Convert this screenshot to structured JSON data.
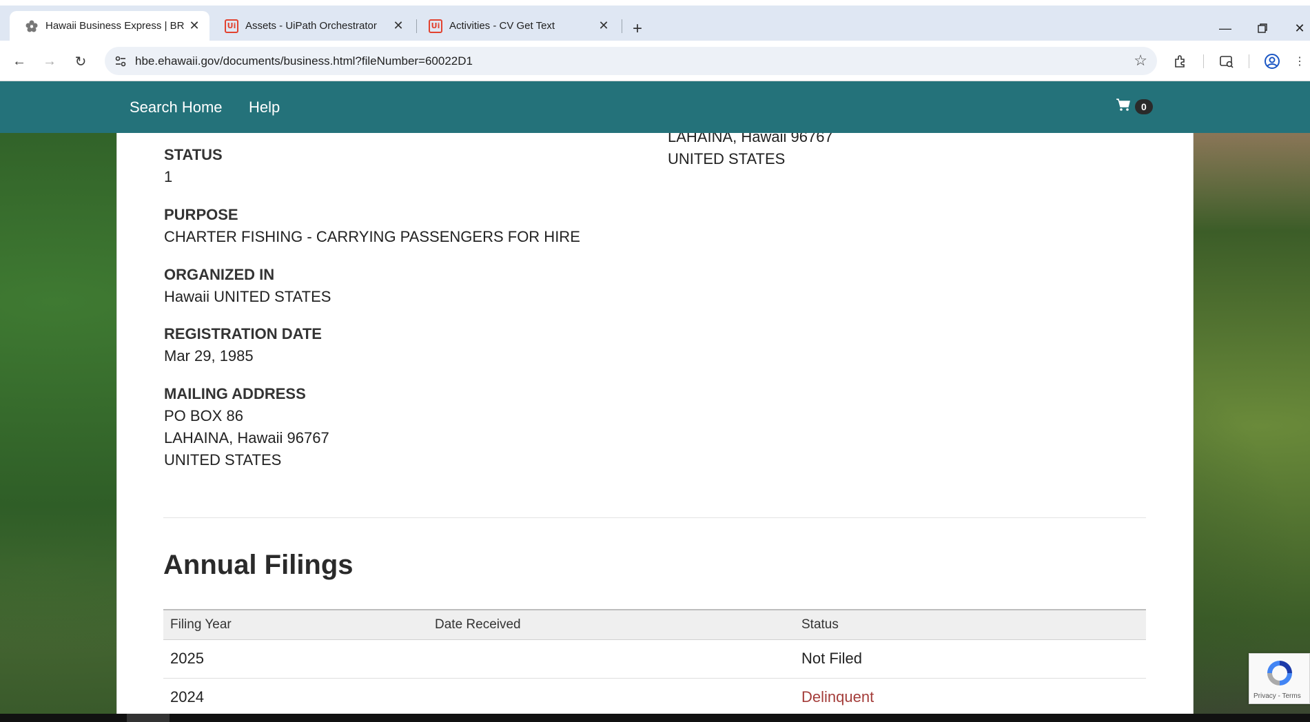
{
  "browser": {
    "tabs": [
      {
        "title": "Hawaii Business Express | BREG",
        "icon": "hibiscus-icon",
        "active": true
      },
      {
        "title": "Assets - UiPath Orchestrator",
        "icon": "uipath-icon",
        "active": false
      },
      {
        "title": "Activities - CV Get Text",
        "icon": "uipath-icon",
        "active": false
      }
    ],
    "uipath_icon_text": "Ui",
    "url": "hbe.ehawaii.gov/documents/business.html?fileNumber=60022D1"
  },
  "header": {
    "nav": [
      "Search Home",
      "Help"
    ],
    "cart_count": "0",
    "background_color": "#24727a"
  },
  "details": {
    "principal_address_line2": "LAHAINA, Hawaii 96767",
    "principal_address_line3": "UNITED STATES",
    "status_label": "STATUS",
    "status_value": "1",
    "purpose_label": "PURPOSE",
    "purpose_value": "CHARTER FISHING - CARRYING PASSENGERS FOR HIRE",
    "organized_label": "ORGANIZED IN",
    "organized_value": "Hawaii UNITED STATES",
    "registration_label": "REGISTRATION DATE",
    "registration_value": "Mar 29, 1985",
    "mailing_label": "MAILING ADDRESS",
    "mailing_lines": [
      "PO BOX 86",
      "LAHAINA, Hawaii 96767",
      "UNITED STATES"
    ]
  },
  "annual_filings": {
    "title": "Annual Filings",
    "columns": [
      "Filing Year",
      "Date Received",
      "Status"
    ],
    "rows": [
      {
        "year": "2025",
        "date_received": "",
        "status": "Not Filed"
      },
      {
        "year": "2024",
        "date_received": "",
        "status": "Delinquent"
      }
    ],
    "delinquent_color": "#a43d3a"
  },
  "recaptcha": {
    "text": "Privacy - Terms"
  }
}
